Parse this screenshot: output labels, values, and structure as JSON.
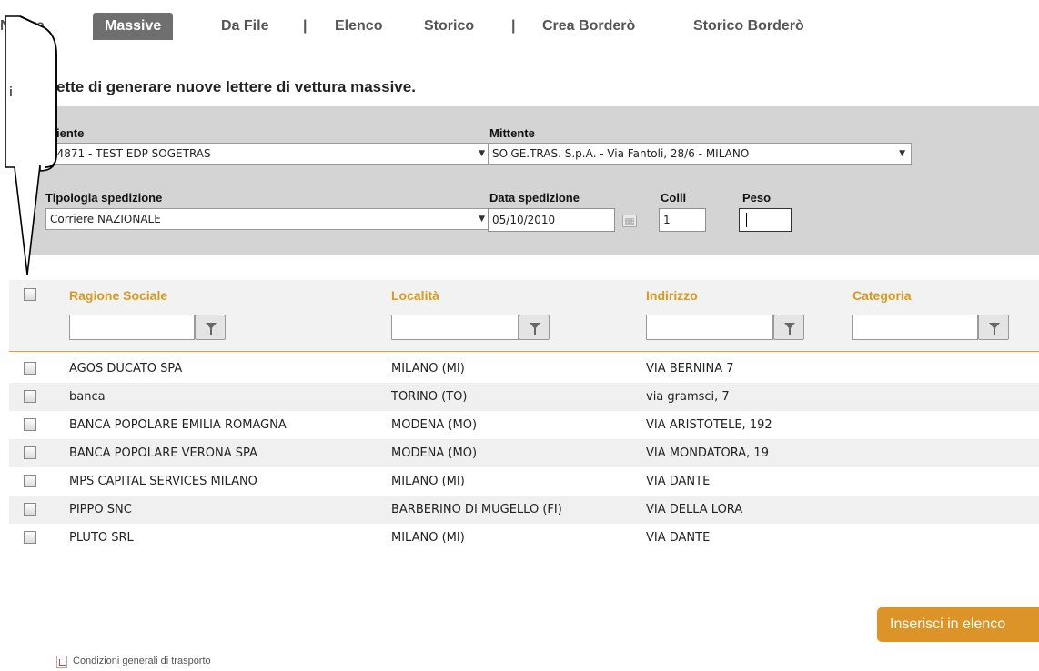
{
  "nav": {
    "items": [
      "Nuova",
      "Massive",
      "Da File",
      "Elenco",
      "Storico",
      "Crea Borderò",
      "Storico Borderò"
    ],
    "separator": "|",
    "active": "Massive"
  },
  "intro": "ette di generare nuove lettere di vettura massive.",
  "callout": {
    "text": "i"
  },
  "form": {
    "cliente": {
      "label": "iente",
      "value": "64871 - TEST EDP SOGETRAS"
    },
    "mittente": {
      "label": "Mittente",
      "value": "SO.GE.TRAS. S.p.A. - Via Fantoli, 28/6 - MILANO"
    },
    "tipologia": {
      "label": "Tipologia spedizione",
      "value": "Corriere NAZIONALE"
    },
    "data": {
      "label": "Data spedizione",
      "value": "05/10/2010"
    },
    "colli": {
      "label": "Colli",
      "value": "1"
    },
    "peso": {
      "label": "Peso",
      "value": ""
    }
  },
  "table": {
    "columns": [
      "Ragione Sociale",
      "Località",
      "Indirizzo",
      "Categoria"
    ],
    "rows": [
      [
        "AGOS DUCATO SPA",
        "MILANO (MI)",
        "VIA BERNINA 7",
        ""
      ],
      [
        "banca",
        "TORINO (TO)",
        "via gramsci, 7",
        ""
      ],
      [
        "BANCA POPOLARE EMILIA ROMAGNA",
        "MODENA (MO)",
        "VIA ARISTOTELE, 192",
        ""
      ],
      [
        "BANCA POPOLARE VERONA SPA",
        "MODENA (MO)",
        "VIA MONDATORA, 19",
        ""
      ],
      [
        "MPS CAPITAL SERVICES MILANO",
        "MILANO (MI)",
        "VIA DANTE",
        ""
      ],
      [
        "PIPPO SNC",
        "BARBERINO DI MUGELLO (FI)",
        "VIA DELLA LORA",
        ""
      ],
      [
        "PLUTO SRL",
        "MILANO (MI)",
        "VIA DANTE",
        ""
      ]
    ]
  },
  "actions": {
    "insert_label": "Inserisci in elenco"
  },
  "footer": {
    "conditions_label": "Condizioni generali di trasporto"
  },
  "colors": {
    "accent": "#dc9327",
    "header_text": "#d79a1f",
    "panel": "#d4d4d4",
    "active_tab": "#6f6f6f"
  },
  "icons": {
    "filter": "funnel-icon",
    "calendar": "calendar-icon",
    "pdf": "pdf-icon"
  }
}
